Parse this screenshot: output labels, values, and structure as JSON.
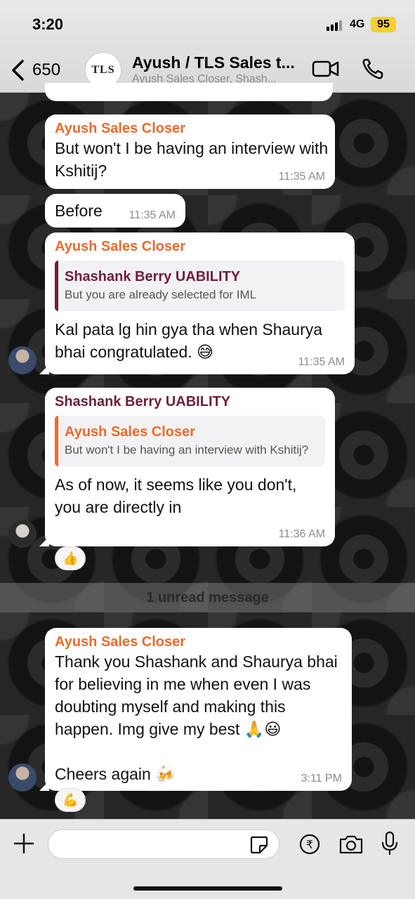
{
  "status_bar": {
    "time": "3:20",
    "network": "4G",
    "battery": "95"
  },
  "header": {
    "back_count": "650",
    "avatar_text": "TLS",
    "title": "Ayush / TLS Sales t...",
    "subtitle": "Ayush Sales Closer, Shash..."
  },
  "messages": [
    {
      "sender": "Ayush Sales Closer",
      "text": "But won't I be having an interview with Kshitij?",
      "time": "11:35 AM"
    },
    {
      "sender": "",
      "text": "Before",
      "time": "11:35 AM"
    },
    {
      "sender": "Ayush Sales Closer",
      "quote": {
        "name": "Shashank Berry UABILITY",
        "text": "But you are already selected for IML"
      },
      "text": "Kal pata lg hin gya tha when Shaurya bhai  congratulated. 😅",
      "time": "11:35 AM"
    },
    {
      "sender": "Shashank Berry UABILITY",
      "quote": {
        "name": "Ayush Sales Closer",
        "text": "But won't I be having an interview with Kshitij?"
      },
      "text": "As of now, it seems like you don't, you are directly in",
      "time": "11:36 AM",
      "reaction": "👍"
    },
    {
      "sender": "Ayush Sales Closer",
      "text": "Thank you Shashank and Shaurya bhai for believing in me when even I was doubting myself and making this happen. Img give my best 🙏😃",
      "text2": "Cheers again 🍻",
      "time": "3:11 PM",
      "reaction": "💪"
    }
  ],
  "unread_label": "1 unread message",
  "colors": {
    "orange_sender": "#ee6a2c",
    "purple_sender": "#6e1e3a",
    "bubble": "#ffffff",
    "wallpaper": "#262626"
  },
  "icons": [
    "back-chevron-icon",
    "video-call-icon",
    "phone-icon",
    "plus-icon",
    "sticker-icon",
    "rupee-icon",
    "camera-icon",
    "microphone-icon"
  ]
}
